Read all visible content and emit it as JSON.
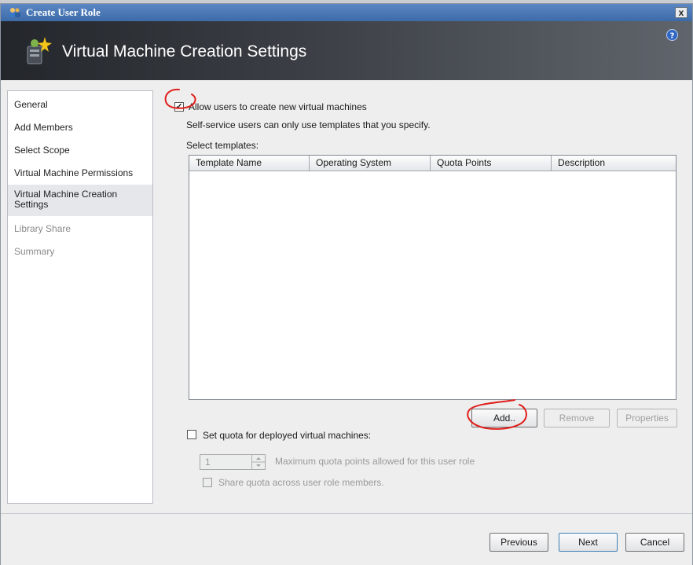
{
  "window": {
    "title": "Create User Role",
    "close_symbol": "x"
  },
  "banner": {
    "title": "Virtual Machine Creation Settings",
    "icon": "wizard-user-icon",
    "help_icon": "help-icon"
  },
  "sidebar": {
    "items": [
      {
        "label": "General",
        "state": "normal"
      },
      {
        "label": "Add Members",
        "state": "normal"
      },
      {
        "label": "Select Scope",
        "state": "normal"
      },
      {
        "label": "Virtual Machine Permissions",
        "state": "normal"
      },
      {
        "label": "Virtual Machine Creation Settings",
        "state": "active"
      },
      {
        "label": "Library Share",
        "state": "disabled"
      },
      {
        "label": "Summary",
        "state": "disabled"
      }
    ]
  },
  "main": {
    "allow_create": {
      "label": "Allow users to create new virtual machines",
      "checked": true
    },
    "hint": "Self-service users can only use templates that you specify.",
    "select_templates_label": "Select templates:",
    "table": {
      "columns": [
        "Template Name",
        "Operating System",
        "Quota Points",
        "Description"
      ],
      "rows": []
    },
    "buttons": {
      "add": "Add..",
      "remove": "Remove",
      "properties": "Properties"
    },
    "quota": {
      "label": "Set quota for deployed virtual machines:",
      "checked": false,
      "value": "1",
      "max_label": "Maximum quota points allowed for this user role",
      "share_label": "Share quota across user role members.",
      "share_checked": false
    }
  },
  "footer": {
    "previous": "Previous",
    "next": "Next",
    "cancel": "Cancel"
  },
  "colors": {
    "titlebar": "#3d6aa8",
    "banner_dark": "#23262b",
    "annotation_red": "#e0201c"
  }
}
